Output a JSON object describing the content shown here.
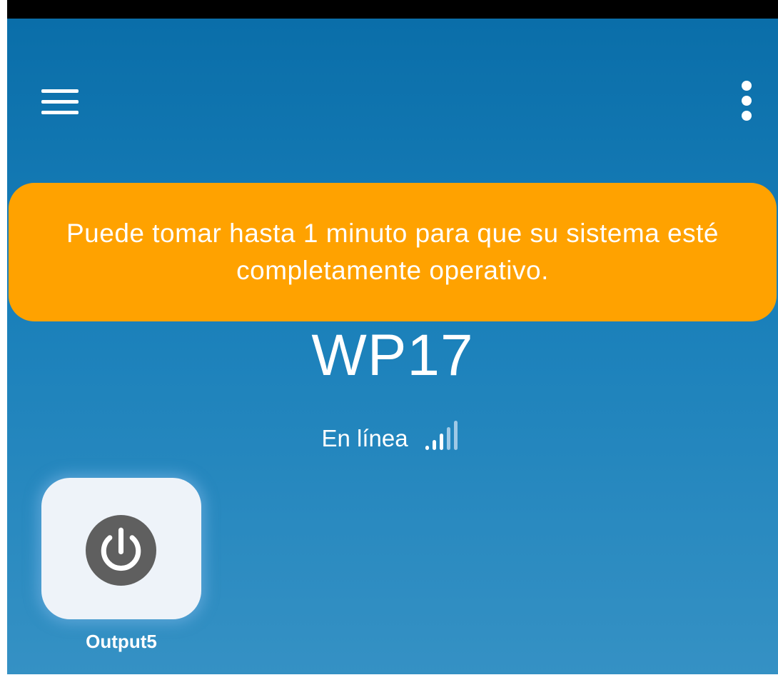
{
  "header": {
    "menu_icon": "hamburger-menu-icon",
    "more_icon": "more-vertical-icon"
  },
  "notification": {
    "message": "Puede tomar hasta 1 minuto para que su sistema esté completamente operativo.",
    "color": "#ffa200"
  },
  "device": {
    "name": "WP17",
    "status": "En línea",
    "signal_icon": "signal-strength-icon",
    "signal_bars_active": 3,
    "signal_bars_total": 5
  },
  "outputs": [
    {
      "label": "Output5",
      "icon": "power-icon"
    }
  ],
  "colors": {
    "background_top": "#0a6ea9",
    "background_bottom": "#3591c4",
    "tile_background": "#eef3f9",
    "power_icon": "#5f5f5f"
  }
}
